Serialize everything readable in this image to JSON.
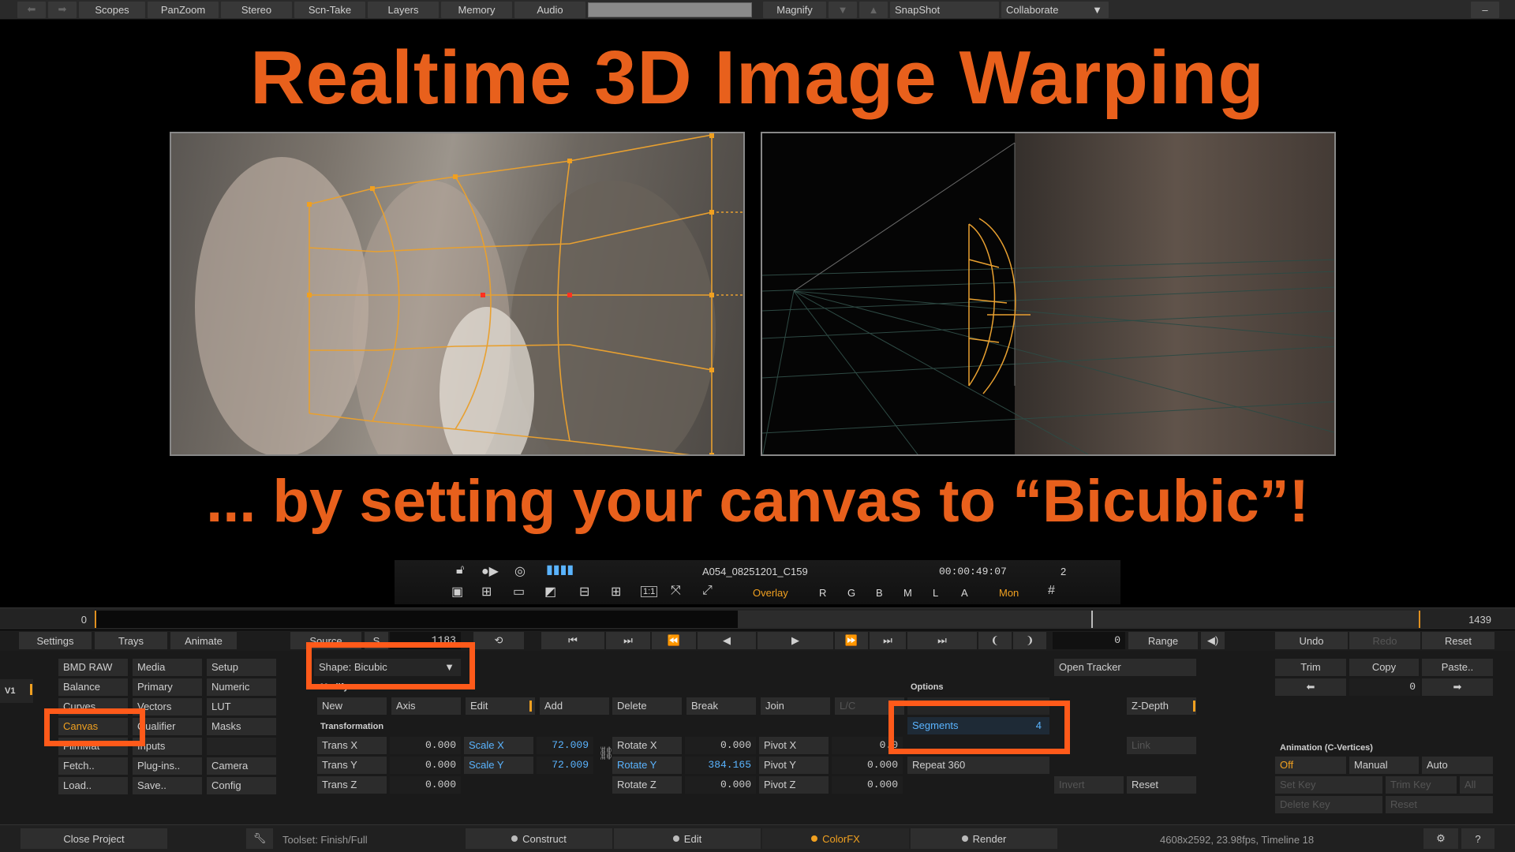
{
  "menubar": {
    "items": [
      "Scopes",
      "PanZoom",
      "Stereo",
      "Scn-Take",
      "Layers",
      "Memory",
      "Audio"
    ],
    "magnify": "Magnify",
    "snapshot": "SnapShot",
    "collaborate": "Collaborate",
    "minimize": "–"
  },
  "headline": {
    "title": "Realtime 3D Image Warping",
    "subtitle": "... by setting your canvas to “Bicubic”!"
  },
  "viewer_status": {
    "clip_name": "A054_08251201_C159",
    "timecode": "00:00:49:07",
    "track_num": "2",
    "overlay": "Overlay",
    "channels": [
      "R",
      "G",
      "B",
      "M",
      "L",
      "A"
    ],
    "monitor": "Mon",
    "zoom_1to1": "1:1"
  },
  "timeline": {
    "start": "0",
    "end": "1439",
    "playhead_fraction": 0.752
  },
  "controls": {
    "settings": "Settings",
    "trays": "Trays",
    "animate": "Animate",
    "source": "Source",
    "s_label": "S",
    "source_frame": "1183",
    "frame_value": "0",
    "range": "Range",
    "undo": "Undo",
    "redo": "Redo",
    "reset": "Reset"
  },
  "track": {
    "label": "V1"
  },
  "menu_grid": {
    "col1": [
      "BMD RAW",
      "Balance",
      "Curves",
      "Canvas",
      "FilmMat",
      "Fetch..",
      "Load.."
    ],
    "col2": [
      "Media",
      "Primary",
      "Vectors",
      "Qualifier",
      "Inputs",
      "Plug-ins..",
      "Save.."
    ],
    "col3": [
      "Setup",
      "Numeric",
      "LUT",
      "Masks",
      "",
      "Camera",
      "Config"
    ]
  },
  "canvas": {
    "shape_select": "Shape: Bicubic",
    "modify_label": "Modify",
    "modify_buttons": [
      "New",
      "Axis",
      "Edit",
      "Add",
      "Delete",
      "Break",
      "Join",
      "L/C"
    ],
    "transformation_label": "Transformation",
    "trans": [
      {
        "label": "Trans X",
        "value": "0.000"
      },
      {
        "label": "Trans Y",
        "value": "0.000"
      },
      {
        "label": "Trans Z",
        "value": "0.000"
      }
    ],
    "scale": [
      {
        "label": "Scale X",
        "value": "72.009"
      },
      {
        "label": "Scale Y",
        "value": "72.009"
      }
    ],
    "rotate": [
      {
        "label": "Rotate X",
        "value": "0.000"
      },
      {
        "label": "Rotate Y",
        "value": "384.165"
      },
      {
        "label": "Rotate Z",
        "value": "0.000"
      }
    ],
    "pivot": [
      {
        "label": "Pivot X",
        "value": "0.0"
      },
      {
        "label": "Pivot Y",
        "value": "0.000"
      },
      {
        "label": "Pivot Z",
        "value": "0.000"
      }
    ]
  },
  "options": {
    "label": "Options",
    "segments_label": "Segments",
    "segments_value": "4",
    "repeat": "Repeat 360",
    "open_tracker": "Open Tracker",
    "zdepth": "Z-Depth",
    "link": "Link",
    "invert": "Invert",
    "reset": "Reset"
  },
  "keyframes": {
    "trim": "Trim",
    "copy": "Copy",
    "paste": "Paste..",
    "key_value": "0",
    "animation_label": "Animation (C-Vertices)",
    "off": "Off",
    "manual": "Manual",
    "auto": "Auto",
    "set_key": "Set Key",
    "trim_key": "Trim Key",
    "all": "All",
    "delete_key": "Delete Key",
    "reset": "Reset"
  },
  "footer": {
    "close_project": "Close Project",
    "toolset": "Toolset: Finish/Full",
    "tabs": [
      "Construct",
      "Edit",
      "ColorFX",
      "Render"
    ],
    "active_tab": "ColorFX",
    "info": "4608x2592, 23.98fps, Timeline 18",
    "help": "?"
  },
  "colors": {
    "accent": "#e8601c",
    "callout": "#ff5a1a",
    "active": "#f0a020",
    "value_blue": "#5ab4ff"
  }
}
